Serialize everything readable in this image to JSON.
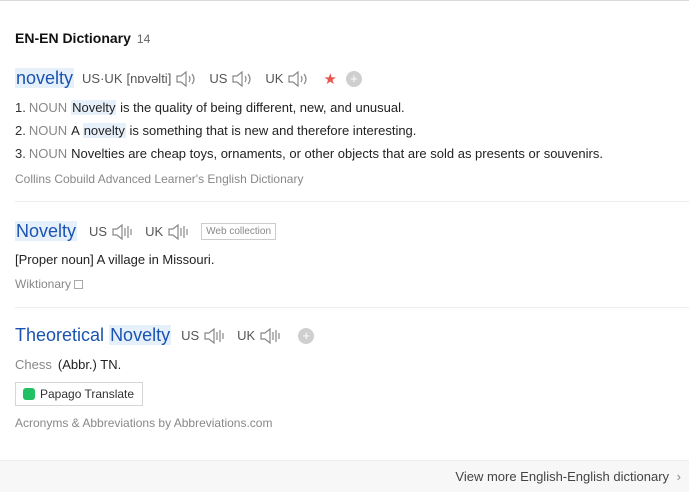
{
  "header": {
    "title": "EN-EN Dictionary",
    "count": "14"
  },
  "entry1": {
    "headword": "novelty",
    "pron_label": "US·UK",
    "pron_text": "[nɒvəlti]",
    "us": "US",
    "uk": "UK",
    "definitions": [
      {
        "num": "1.",
        "pos": "NOUN",
        "keyword": "Novelty",
        "pre": "",
        "text": " is the quality of being different, new, and unusual."
      },
      {
        "num": "2.",
        "pos": "NOUN",
        "pre": "A ",
        "keyword": "novelty",
        "text": " is something that is new and therefore interesting."
      },
      {
        "num": "3.",
        "pos": "NOUN",
        "pre": "",
        "keyword": "",
        "text": "Novelties are cheap toys, ornaments, or other objects that are sold as presents or souvenirs."
      }
    ],
    "source": "Collins Cobuild Advanced Learner's English Dictionary"
  },
  "entry2": {
    "headword": "Novelty",
    "us": "US",
    "uk": "UK",
    "tag": "Web collection",
    "definition": "[Proper noun] A village in Missouri.",
    "source": "Wiktionary"
  },
  "entry3": {
    "headword_prefix": "Theoretical",
    "headword_hl": "Novelty",
    "us": "US",
    "uk": "UK",
    "category": "Chess",
    "definition": "(Abbr.) TN.",
    "papago": "Papago Translate",
    "source": "Acronyms & Abbreviations by Abbreviations.com"
  },
  "footer": {
    "more_label": "View more English-English dictionary"
  },
  "colors": {
    "headword": "#1a53b0",
    "highlight": "#e6f0fb",
    "star": "#e8554e",
    "papago": "#20c063"
  }
}
